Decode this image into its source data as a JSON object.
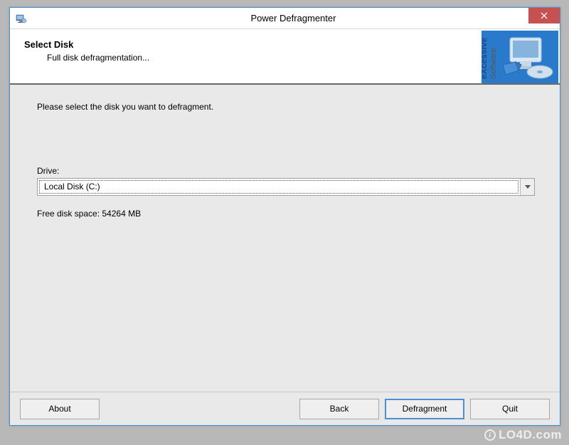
{
  "window": {
    "title": "Power Defragmenter"
  },
  "header": {
    "title": "Select Disk",
    "subtitle": "Full disk defragmentation...",
    "logo_brand": "eXcessive",
    "logo_type": "Software"
  },
  "content": {
    "instruction": "Please select the disk you want to defragment.",
    "drive_label": "Drive:",
    "drive_selected": "Local Disk (C:)",
    "free_space": "Free disk space: 54264 MB"
  },
  "footer": {
    "about": "About",
    "back": "Back",
    "defragment": "Defragment",
    "quit": "Quit"
  },
  "watermark": "LO4D.com"
}
